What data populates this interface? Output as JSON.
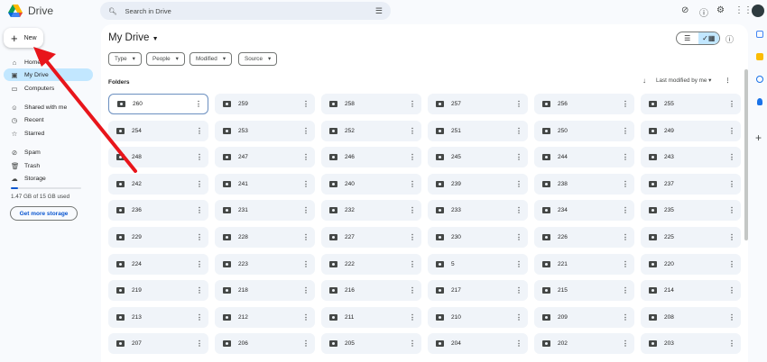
{
  "app": {
    "name": "Drive"
  },
  "search": {
    "placeholder": "Search in Drive"
  },
  "new_label": "New",
  "nav": [
    {
      "label": "Home",
      "icon": "home-icon"
    },
    {
      "label": "My Drive",
      "icon": "my-drive-icon"
    },
    {
      "label": "Computers",
      "icon": "computers-icon"
    },
    {
      "label": "Shared with me",
      "icon": "shared-icon"
    },
    {
      "label": "Recent",
      "icon": "clock-icon"
    },
    {
      "label": "Starred",
      "icon": "star-icon"
    },
    {
      "label": "Spam",
      "icon": "spam-icon"
    },
    {
      "label": "Trash",
      "icon": "trash-icon"
    },
    {
      "label": "Storage",
      "icon": "cloud-icon"
    }
  ],
  "storage": {
    "text": "1.47 GB of 15 GB used",
    "fraction": 0.098,
    "button": "Get more storage"
  },
  "main": {
    "title": "My Drive",
    "filters": [
      "Type",
      "People",
      "Modified",
      "Source"
    ],
    "section": "Folders",
    "sort": "Last modified by me"
  },
  "folders": [
    "260",
    "259",
    "258",
    "257",
    "256",
    "255",
    "254",
    "253",
    "252",
    "251",
    "250",
    "249",
    "248",
    "247",
    "246",
    "245",
    "244",
    "243",
    "242",
    "241",
    "240",
    "239",
    "238",
    "237",
    "236",
    "231",
    "232",
    "233",
    "234",
    "235",
    "229",
    "228",
    "227",
    "230",
    "226",
    "225",
    "224",
    "223",
    "222",
    "5",
    "221",
    "220",
    "219",
    "218",
    "216",
    "217",
    "215",
    "214",
    "213",
    "212",
    "211",
    "210",
    "209",
    "208",
    "207",
    "206",
    "205",
    "204",
    "202",
    "203"
  ],
  "colors": {
    "accent": "#0b57d0",
    "selected_nav": "#c2e7ff",
    "arrow": "#e8151b"
  }
}
